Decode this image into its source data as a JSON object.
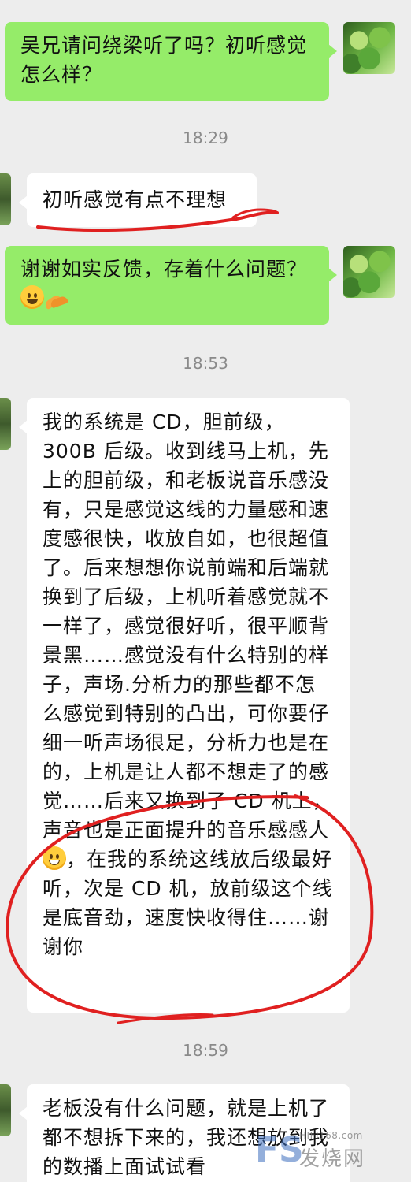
{
  "messages": [
    {
      "side": "right",
      "text": "吴兄请问绕梁听了吗？初听感觉怎么样？"
    },
    {
      "time": "18:29"
    },
    {
      "side": "left",
      "text": "初听感觉有点不理想"
    },
    {
      "side": "right",
      "text": "谢谢如实反馈，存着什么问题？",
      "emojis": [
        "smile-emoji",
        "clap-hands-emoji"
      ]
    },
    {
      "time": "18:53"
    },
    {
      "side": "left",
      "text_part1": "我的系统是 CD，胆前级，300B 后级。收到线马上机，先上的胆前级，和老板说音乐感没有，只是感觉这线的力量感和速度感很快，收放自如，也很超值了。后来想想你说前端和后端就换到了后级，上机听着感觉就不一样了，感觉很好听，很平顺背景黑……感觉没有什么特别的样子，声场.分析力的那些都不怎么感觉到特别的凸出，可你要仔细一听声场很足，分析力也是在的，上机是让人都不想走了的感觉……后来又换到了 CD 机上，声音也是正面提升的音乐感感人",
      "emoji": "grin-emoji",
      "text_part2": "，在我的系统这线放后级最好听，次是 CD 机，放前级这个线是底音劲，速度快收得住……谢谢你"
    },
    {
      "time": "18:59"
    },
    {
      "side": "left",
      "text": "老板没有什么问题，就是上机了都不想拆下来的，我还想放到我的数播上面试试看"
    }
  ],
  "watermark": {
    "logo": "FS",
    "site": "HIFI168.com",
    "name": "发烧网"
  },
  "colors": {
    "background": "#ededed",
    "bubble_self": "#95ec69",
    "bubble_other": "#ffffff",
    "annotation": "#e02020"
  }
}
